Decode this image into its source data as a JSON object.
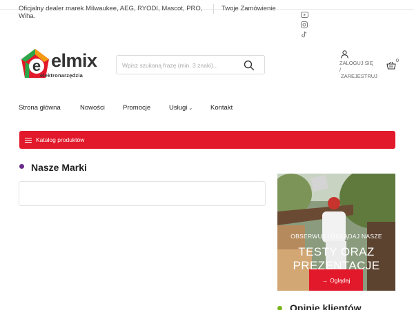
{
  "topbar": {
    "dealer_text": "Oficjalny dealer marek Milwaukee, AEG, RYODI, Mascot, PRO, Wiha.",
    "orders_link": "Twoje Zamówienie",
    "social": [
      "youtube-icon",
      "instagram-icon",
      "tiktok-icon"
    ]
  },
  "logo": {
    "brand": "elmix",
    "tagline": "elektronarzędzia"
  },
  "search": {
    "placeholder": "Wpisz szukaną frazę (min. 3 znaki)..."
  },
  "account": {
    "login": "ZALOGUJ SIĘ",
    "separator": "/",
    "register": "ZAREJESTRUJ"
  },
  "cart": {
    "count": "0"
  },
  "nav": {
    "items": [
      {
        "label": "Strona główna"
      },
      {
        "label": "Nowości"
      },
      {
        "label": "Promocje"
      },
      {
        "label": "Usługi",
        "has_dropdown": true
      },
      {
        "label": "Kontakt"
      }
    ]
  },
  "catalog": {
    "label": "Katalog produktów"
  },
  "brands": {
    "title": "Nasze Marki"
  },
  "promo": {
    "kicker": "OBSERWUJ I OGLĄDAJ NASZE",
    "title_line1": "TESTY ORAZ",
    "title_line2": "PREZENTACJE",
    "button_label": "Oglądaj"
  },
  "opinions": {
    "title": "Opinie klientów"
  },
  "colors": {
    "accent_red": "#e2192b",
    "brands_dot": "#6a2c8c",
    "opinions_dot": "#7ab51d"
  }
}
